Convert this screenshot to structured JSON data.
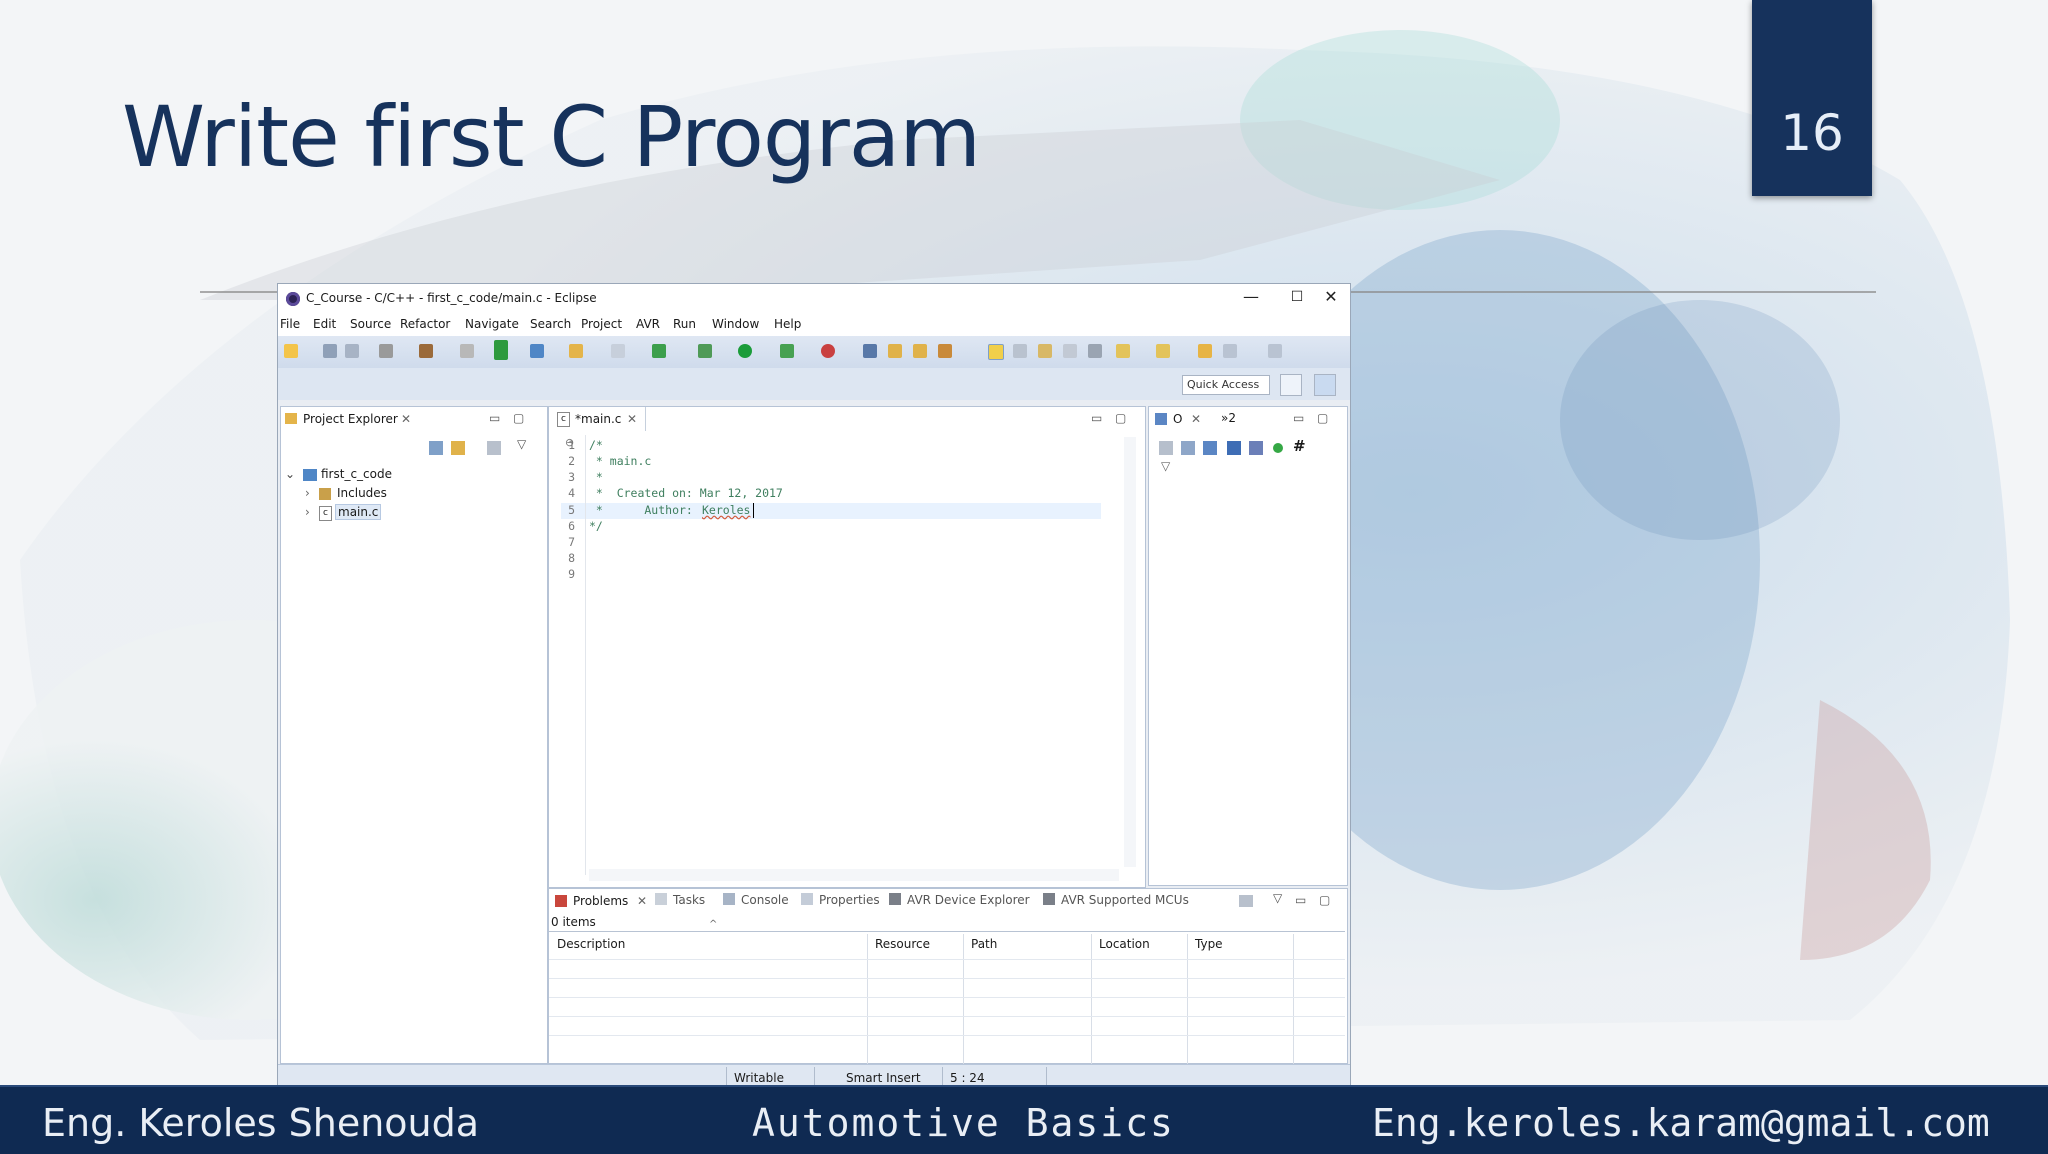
{
  "slide": {
    "title": "Write first C Program",
    "page_number": "16",
    "footer_left": "Eng. Keroles Shenouda",
    "footer_center": "Automotive Basics",
    "footer_right": "Eng.keroles.karam@gmail.com"
  },
  "window": {
    "title": "C_Course - C/C++ - first_c_code/main.c - Eclipse",
    "minimize": "—",
    "maximize": "☐",
    "close": "✕"
  },
  "menu": [
    "File",
    "Edit",
    "Source",
    "Refactor",
    "Navigate",
    "Search",
    "Project",
    "AVR",
    "Run",
    "Window",
    "Help"
  ],
  "toolbar": {
    "quick_access": "Quick Access"
  },
  "project_explorer": {
    "tab_label": "Project Explorer",
    "project": "first_c_code",
    "items": [
      "Includes",
      "main.c"
    ]
  },
  "editor": {
    "tab_label": "*main.c",
    "line_numbers": [
      "1",
      "2",
      "3",
      "4",
      "5",
      "6",
      "7",
      "8",
      "9"
    ],
    "lines": [
      "/*",
      " * main.c",
      " *",
      " *  Created on: Mar 12, 2017",
      " *      Author: ",
      "*/",
      "",
      "",
      ""
    ],
    "author_name": "Keroles",
    "fold_marker": "⊖"
  },
  "outline": {
    "tab_label": "O",
    "tab2_label": "»2"
  },
  "bottom_panel": {
    "tabs": [
      "Problems",
      "Tasks",
      "Console",
      "Properties",
      "AVR Device Explorer",
      "AVR Supported MCUs"
    ],
    "items_count": "0 items",
    "columns": [
      "Description",
      "Resource",
      "Path",
      "Location",
      "Type"
    ]
  },
  "statusbar": {
    "mode": "Writable",
    "insert": "Smart Insert",
    "position": "5 : 24"
  },
  "colors": {
    "slide_navy": "#16325c",
    "footer_navy": "#0f2a52",
    "comment_green": "#3f7f5f",
    "eclipse_blue": "#cfdbec"
  }
}
